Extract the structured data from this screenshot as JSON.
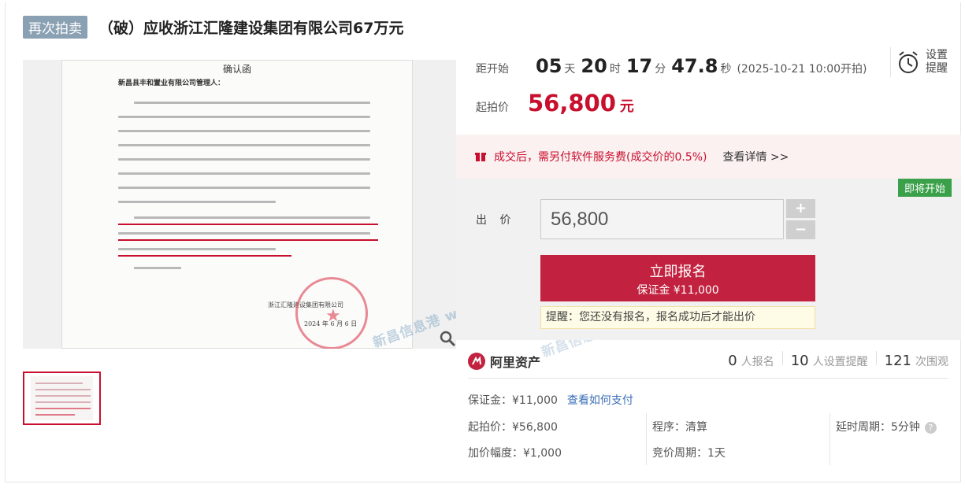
{
  "title": {
    "badge": "再次拍卖",
    "text": "（破）应收浙江汇隆建设集团有限公司67万元"
  },
  "document": {
    "heading": "确认函",
    "salutation": "新昌县丰和置业有限公司管理人：",
    "signature": "浙江汇隆建设集团有限公司",
    "date": "2024 年 6 月 6 日"
  },
  "watermark": "新昌信息港 www.nlxc.com",
  "countdown": {
    "label": "距开始",
    "days": "05",
    "days_unit": "天",
    "hours": "20",
    "hours_unit": "时",
    "minutes": "17",
    "minutes_unit": "分",
    "seconds": "47.8",
    "seconds_unit": "秒",
    "start_time": "(2025-10-21 10:00开拍)"
  },
  "remind": {
    "line1": "设置",
    "line2": "提醒"
  },
  "start_price": {
    "label": "起拍价",
    "value": "56,800",
    "unit": "元"
  },
  "notice": {
    "text": "成交后，需另付软件服务费(成交价的0.5%)",
    "link": "查看详情 >>"
  },
  "bid": {
    "badge": "即将开始",
    "label": "出 价",
    "value": "56,800",
    "plus": "+",
    "minus": "−",
    "signup_main": "立即报名",
    "signup_sub": "保证金 ¥11,000",
    "hint": "提醒：您还没有报名，报名成功后才能出价"
  },
  "ali": {
    "name": "阿里资产",
    "stats": [
      {
        "num": "0",
        "label": "人报名"
      },
      {
        "num": "10",
        "label": "人设置提醒"
      },
      {
        "num": "121",
        "label": "次围观"
      }
    ]
  },
  "info": {
    "deposit": "保证金：¥11,000",
    "deposit_link": "查看如何支付",
    "start_price": "起拍价：¥56,800",
    "procedure": "程序：清算",
    "delay": "延时周期：5分钟",
    "increment": "加价幅度：¥1,000",
    "cycle": "竞价周期：1天"
  }
}
